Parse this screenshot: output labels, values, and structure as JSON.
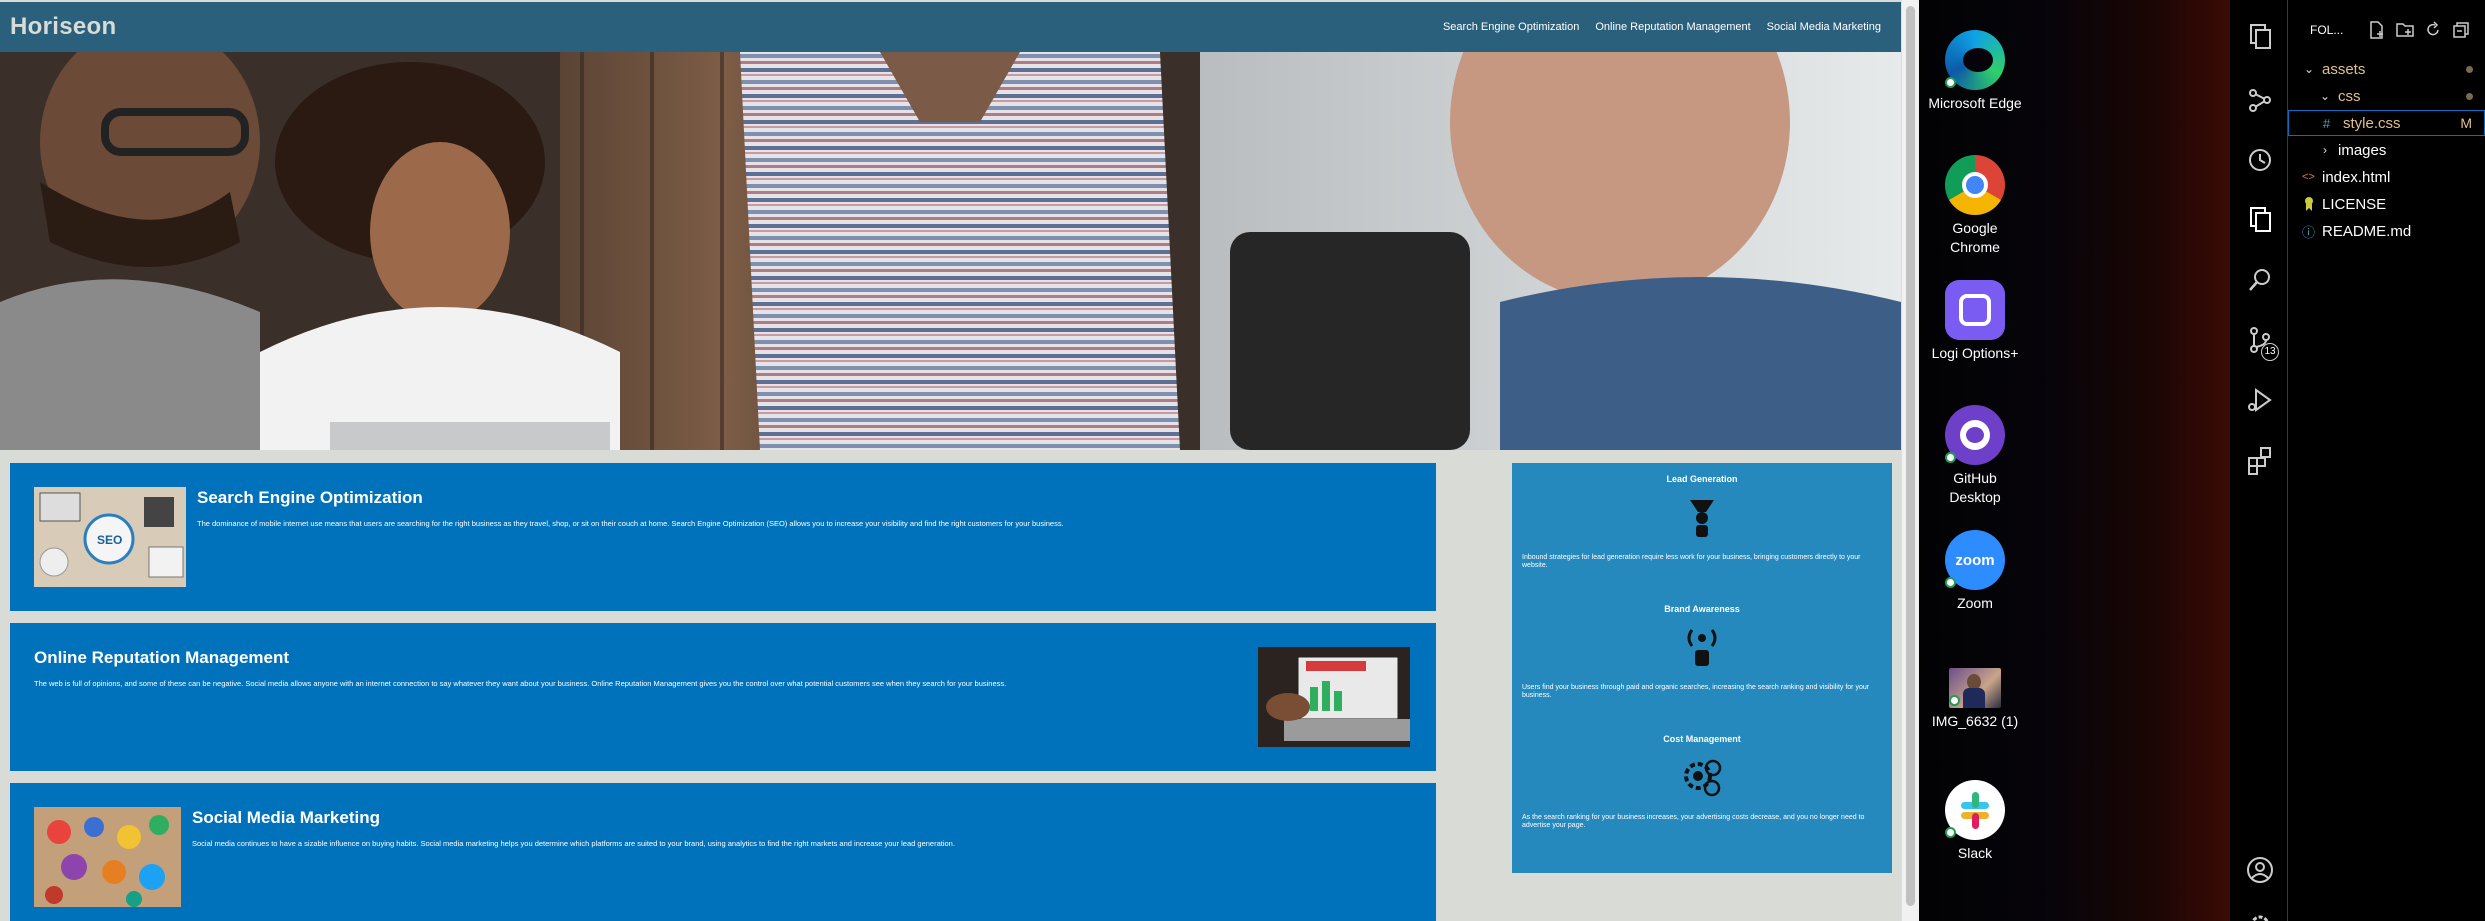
{
  "site": {
    "logo": "Horiseon",
    "nav": [
      "Search Engine Optimization",
      "Online Reputation Management",
      "Social Media Marketing"
    ],
    "cards": [
      {
        "title": "Search Engine Optimization",
        "text": "The dominance of mobile internet use means that users are searching for the right business as they travel, shop, or sit on their couch at home. Search Engine Optimization (SEO) allows you to increase your visibility and find the right customers for your business."
      },
      {
        "title": "Online Reputation Management",
        "text": "The web is full of opinions, and some of these can be negative. Social media allows anyone with an internet connection to say whatever they want about your business. Online Reputation Management gives you the control over what potential customers see when they search for your business."
      },
      {
        "title": "Social Media Marketing",
        "text": "Social media continues to have a sizable influence on buying habits. Social media marketing helps you determine which platforms are suited to your brand, using analytics to find the right markets and increase your lead generation."
      }
    ],
    "benefits": [
      {
        "title": "Lead Generation",
        "icon": "lead-generation-icon",
        "text": "Inbound strategies for lead generation require less work for your business, bringing customers directly to your website."
      },
      {
        "title": "Brand Awareness",
        "icon": "brand-awareness-icon",
        "text": "Users find your business through paid and organic searches, increasing the search ranking and visibility for your business."
      },
      {
        "title": "Cost Management",
        "icon": "cost-management-icon",
        "text": "As the search ranking for your business increases, your advertising costs decrease, and you no longer need to advertise your page."
      }
    ]
  },
  "desktop": {
    "icons": [
      {
        "label": "Microsoft Edge",
        "icon": "edge-icon"
      },
      {
        "label": "Google Chrome",
        "icon": "chrome-icon"
      },
      {
        "label": "Logi Options+",
        "icon": "logi-icon"
      },
      {
        "label": "GitHub Desktop",
        "icon": "github-icon"
      },
      {
        "label": "Zoom",
        "icon": "zoom-icon",
        "logo_text": "zoom"
      },
      {
        "label": "IMG_6632 (1)",
        "icon": "photo-thumbnail-icon"
      },
      {
        "label": "Slack",
        "icon": "slack-icon"
      }
    ]
  },
  "vscode": {
    "explorer_title": "FOL...",
    "source_control_badge": "13",
    "tree": [
      {
        "label": "assets",
        "kind": "folder"
      },
      {
        "label": "css",
        "kind": "folder"
      },
      {
        "label": "style.css",
        "kind": "css",
        "glyph": "#",
        "status": "M"
      },
      {
        "label": "images",
        "kind": "folder"
      },
      {
        "label": "index.html",
        "kind": "html",
        "glyph": "<>"
      },
      {
        "label": "LICENSE",
        "kind": "license"
      },
      {
        "label": "README.md",
        "kind": "info",
        "glyph": "ⓘ"
      }
    ]
  },
  "colors": {
    "header": "#2a607c",
    "card": "#0072bb",
    "aside": "#2589bd",
    "page_bg": "#d9dcd6",
    "tree_folder": "#e2c08d",
    "tree_modified": "#e2c08d"
  }
}
